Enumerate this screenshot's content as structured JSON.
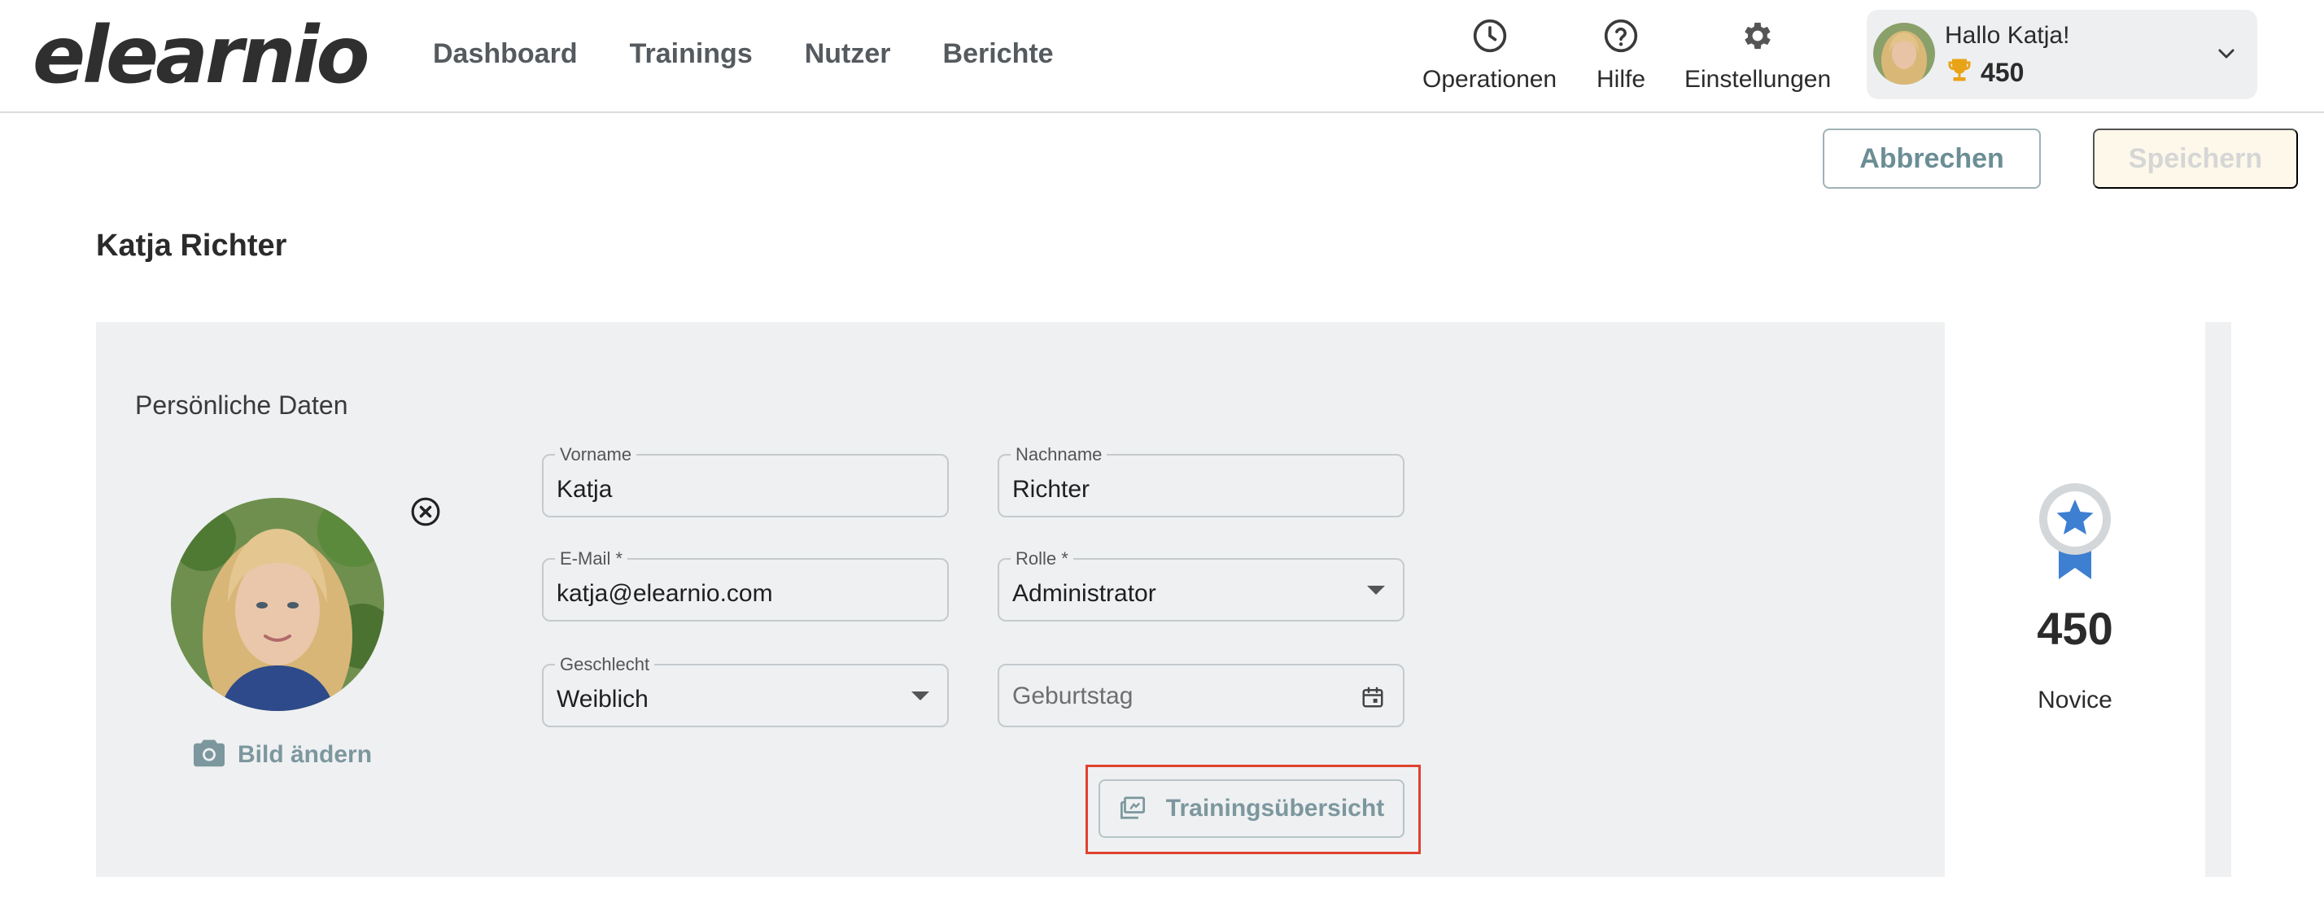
{
  "brand": {
    "logo_text": "elearnio"
  },
  "nav": {
    "items": [
      {
        "label": "Dashboard"
      },
      {
        "label": "Trainings"
      },
      {
        "label": "Nutzer"
      },
      {
        "label": "Berichte"
      }
    ]
  },
  "header_actions": {
    "operations": {
      "label": "Operationen",
      "icon": "clock-icon"
    },
    "help": {
      "label": "Hilfe",
      "icon": "help-circle-icon"
    },
    "settings": {
      "label": "Einstellungen",
      "icon": "gear-icon"
    }
  },
  "user": {
    "greeting": "Hallo Katja!",
    "points": "450",
    "trophy_color": "#e8a317"
  },
  "toolbar": {
    "cancel_label": "Abbrechen",
    "save_label": "Speichern"
  },
  "page": {
    "title": "Katja Richter"
  },
  "personal": {
    "section_title": "Persönliche Daten",
    "change_photo_label": "Bild ändern",
    "fields": {
      "first_name": {
        "label": "Vorname",
        "value": "Katja"
      },
      "last_name": {
        "label": "Nachname",
        "value": "Richter"
      },
      "email": {
        "label": "E-Mail *",
        "value": "katja@elearnio.com"
      },
      "role": {
        "label": "Rolle *",
        "value": "Administrator"
      },
      "gender": {
        "label": "Geschlecht",
        "value": "Weiblich"
      },
      "birthday": {
        "placeholder": "Geburtstag"
      }
    },
    "training_overview_label": "Trainingsübersicht"
  },
  "badge": {
    "points": "450",
    "level": "Novice",
    "star_color": "#3d7fd1",
    "ring_color": "#d3d7da"
  },
  "colors": {
    "accent": "#7c979d",
    "highlight": "#e0412f",
    "card_bg": "#eef0f2"
  }
}
